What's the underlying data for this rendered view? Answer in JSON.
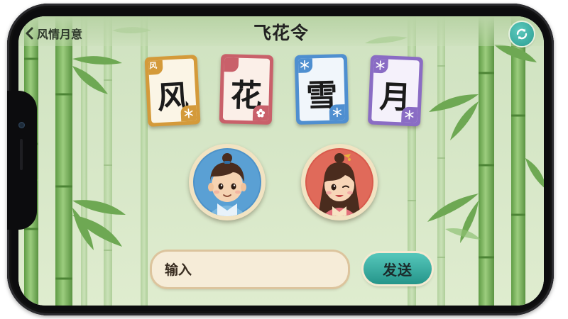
{
  "header": {
    "back_label": "风情月意",
    "title": "飞花令",
    "back_icon": "chevron-left-icon",
    "refresh_icon": "refresh-icon"
  },
  "cards": [
    {
      "char": "风",
      "corner_label": "风",
      "corner_icon": "snowflake-icon",
      "accent": "#d49a3a"
    },
    {
      "char": "花",
      "corner_label": "",
      "corner_icon": "flower-icon",
      "accent": "#c9606a"
    },
    {
      "char": "雪",
      "corner_label": "",
      "corner_icon": "snowflake-icon",
      "accent": "#4f8fd0"
    },
    {
      "char": "月",
      "corner_label": "",
      "corner_icon": "snowflake-icon",
      "accent": "#8a6cc4"
    }
  ],
  "players": [
    {
      "name": "player-boy",
      "frame_color": "#4d92c9"
    },
    {
      "name": "player-girl",
      "frame_color": "#d85a4c"
    }
  ],
  "input": {
    "placeholder": "输入",
    "value": ""
  },
  "send_label": "发送",
  "colors": {
    "bamboo": "#7bb562",
    "bamboo_dark": "#5e9a48",
    "background": "#d3e4c4",
    "teal": "#2a9d92"
  }
}
